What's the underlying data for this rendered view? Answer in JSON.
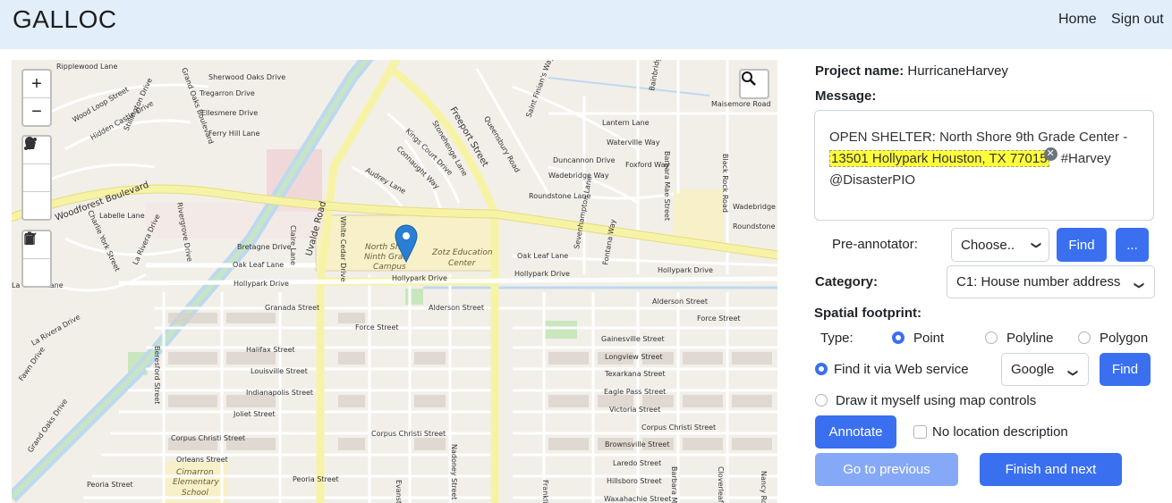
{
  "app": {
    "brand": "GALLOC"
  },
  "nav": {
    "home": "Home",
    "sign_out": "Sign out"
  },
  "map": {
    "zoom_in": "+",
    "zoom_out": "−",
    "streets": {
      "ripplewood": "Ripplewood Lane",
      "sherwood_oaks": "Sherwood Oaks Drive",
      "tregarron": "Tregarron Drive",
      "ellesmere": "Ellesmere Drive",
      "ferry_hill": "Ferry Hill Lane",
      "wood_loop": "Wood Loop Street",
      "hidden_castle": "Hidden Castle Drive",
      "stillington": "Stillington Drive",
      "grand_oaks": "Grand Oaks Boulevard",
      "woodforest": "Woodforest Boulevard",
      "labelle": "Labelle Lane",
      "charlie_york": "Charlie York Street",
      "la_rivera": "La Rivera Drive",
      "rivergrove": "Rivergrove Drive",
      "bretagne": "Bretagne Drive",
      "oak_leaf": "Oak Leaf Lane",
      "oak_leaf_2": "Oak Leaf Lane",
      "hollypark_w": "Hollypark Drive",
      "hollypark_c": "Hollypark Drive",
      "hollypark_e": "Hollypark Drive",
      "hollypark_e2": "Hollypark Drive",
      "la_grove": "La Grove Lane",
      "granada": "Granada Street",
      "alderson": "Alderson Street",
      "alderson_e": "Alderson Street",
      "force": "Force Street",
      "force_e": "Force Street",
      "halifax": "Halifax Street",
      "louisville": "Louisville Street",
      "indianapolis": "Indianapolis Street",
      "joliet": "Joliet Street",
      "corpus_christi_w": "Corpus Christi Street",
      "corpus_christi_c": "Corpus Christi Street",
      "corpus_christi_e": "Corpus Christi Street",
      "orleans": "Orleans Street",
      "peoria": "Peoria Street",
      "peoria_c": "Peoria Street",
      "gainesville": "Gainesville Street",
      "longview": "Longview Street",
      "texarkana": "Texarkana Street",
      "eagle_pass": "Eagle Pass Street",
      "victoria": "Victoria Street",
      "brownsville": "Brownsville Street",
      "laredo": "Laredo Street",
      "hillsboro": "Hillsboro Street",
      "waxahachie": "Waxahachie Street",
      "uvalde": "Uvalde Road",
      "freeport": "Freeport Street",
      "audrey": "Audrey Lane",
      "kings_court": "Kings Court Drive",
      "connaught": "Connaught Way",
      "stonehenge": "Stonehenge Lane",
      "queensbury": "Queensbury Road",
      "lantern": "Lantern Lane",
      "waterville": "Waterville Way",
      "duncannon": "Duncannon Drive",
      "foxford": "Foxford Way",
      "wadebridge": "Wadebridge Way",
      "wadebridge_e": "Wadebridge",
      "roundstone": "Roundstone Lane",
      "roundstone_e": "Roundstone",
      "maisemore": "Maisemore Road",
      "black_rock": "Black Rock Road",
      "barbara_mae": "Barbara Mae Street",
      "saint_finians": "Saint Finian's Way",
      "seventh_ave": "Sevenhampton Lane",
      "fontana": "Fontana Way",
      "bretagne_e": "Bretagne",
      "white_cedar": "White Cedar Drive",
      "claire": "Claire Lane",
      "beresford": "Beresford Street",
      "fawn": "Fawn Drive",
      "grand_oaks_s": "Grand Oaks Drive",
      "evanston": "Evanston",
      "franklin": "Franklin",
      "nadoney": "Nadoney Street",
      "cloverleaf": "Cloverleaf",
      "barbara_s": "Barbara M",
      "nancy": "Nancy Ro",
      "bainbridge": "Bainbridge"
    },
    "places": {
      "north_shore": "North Shore Ninth Grade Campus",
      "north_shore_l1": "North Sh",
      "north_shore_l2": "Ninth Grad",
      "north_shore_l3": "Campus",
      "zotz_l1": "Zotz Education",
      "zotz_l2": "Center",
      "cimarron_l1": "Cimarron",
      "cimarron_l2": "Elementary",
      "cimarron_l3": "School"
    }
  },
  "form": {
    "project_label": "Project name:",
    "project_value": "HurricaneHarvey",
    "message_label": "Message:",
    "message_before": "OPEN SHELTER: North Shore 9th Grade Center - ",
    "message_highlight": "13501 Hollypark Houston, TX 77015",
    "message_after": " #Harvey @DisasterPIO",
    "preannotator_label": "Pre-annotator:",
    "preannotator_value": "Choose..",
    "find_button": "Find",
    "more_button": "...",
    "category_label": "Category:",
    "category_value": "C1: House number address",
    "spatial_label": "Spatial footprint:",
    "type_label": "Type:",
    "type_point": "Point",
    "type_polyline": "Polyline",
    "type_polygon": "Polygon",
    "webservice_label": "Find it via Web service",
    "webservice_value": "Google",
    "webservice_find": "Find",
    "draw_label": "Draw it myself using map controls",
    "annotate_button": "Annotate",
    "no_location_label": "No location description",
    "prev_button": "Go to previous",
    "next_button": "Finish and next"
  },
  "colors": {
    "header_bg": "#e3eefb",
    "primary": "#3a70f0",
    "highlight": "#ffff3a",
    "marker": "#2a7fd4"
  }
}
